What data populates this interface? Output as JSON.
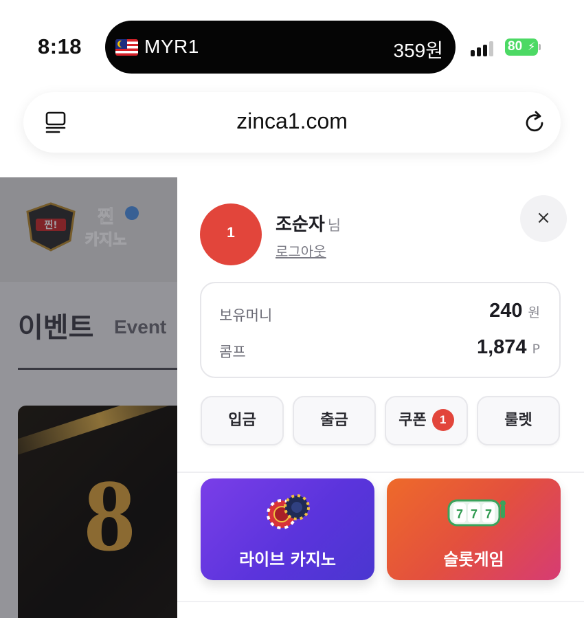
{
  "status_bar": {
    "time": "8:18",
    "island_currency": "MYR1",
    "island_amount": "359원",
    "battery_percent": "80"
  },
  "browser": {
    "url": "zinca1.com"
  },
  "background_page": {
    "logo_text": "찐! 찐 카지노",
    "section_title": "이벤트",
    "section_subtitle": "Event",
    "banner_text": "8"
  },
  "panel": {
    "avatar_text": "1",
    "user_name": "조순자",
    "user_suffix": "님",
    "logout_label": "로그아웃",
    "close_label": "×",
    "balance": {
      "money_label": "보유머니",
      "money_value": "240",
      "money_unit": "원",
      "comp_label": "콤프",
      "comp_value": "1,874",
      "comp_unit": "P"
    },
    "actions": {
      "deposit": "입금",
      "withdraw": "출금",
      "coupon": "쿠폰",
      "coupon_count": "1",
      "roulette": "룰렛"
    },
    "games": {
      "live_casino": "라이브 카지노",
      "slot_game": "슬롯게임"
    }
  },
  "colors": {
    "accent_red": "#e2453b",
    "live_gradient_start": "#7a3ee8",
    "slot_gradient_start": "#ee6a2a"
  }
}
